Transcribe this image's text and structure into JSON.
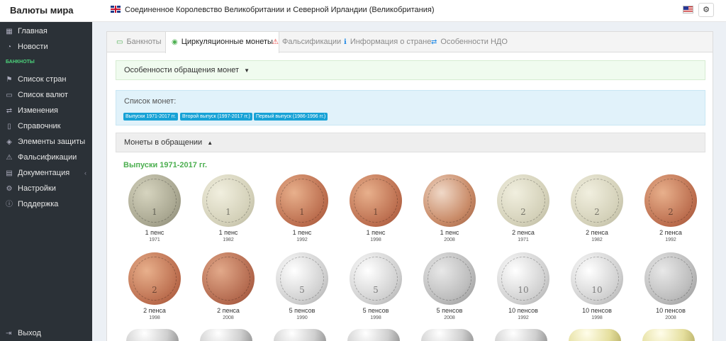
{
  "header": {
    "brand": "Валюты мира",
    "country": "Соединенное Королевство Великобритании и Северной Ирландии (Великобритания)",
    "settings_icon": "gear-icon"
  },
  "sidebar": {
    "section_label": "БАНКНОТЫ",
    "items": [
      {
        "label": "Главная",
        "icon": "dashboard-icon"
      },
      {
        "label": "Новости",
        "icon": "rss-icon"
      },
      {
        "label": "Список стран",
        "icon": "flag-icon"
      },
      {
        "label": "Список валют",
        "icon": "money-icon"
      },
      {
        "label": "Изменения",
        "icon": "exchange-icon"
      },
      {
        "label": "Справочник",
        "icon": "book-icon"
      },
      {
        "label": "Элементы защиты",
        "icon": "layers-icon"
      },
      {
        "label": "Фальсификации",
        "icon": "warning-icon"
      },
      {
        "label": "Документация",
        "icon": "folder-icon"
      },
      {
        "label": "Настройки",
        "icon": "gear-icon"
      },
      {
        "label": "Поддержка",
        "icon": "info-icon"
      }
    ],
    "logout": "Выход"
  },
  "tabs": [
    {
      "label": "Банкноты",
      "icon": "banknote-icon"
    },
    {
      "label": "Циркуляционные монеты",
      "icon": "coin-icon"
    },
    {
      "label": "Фальсификации",
      "icon": "warning-icon"
    },
    {
      "label": "Информация о стране",
      "icon": "info-icon"
    },
    {
      "label": "Особенности НДО",
      "icon": "exchange-icon"
    }
  ],
  "features_box": "Особенности обращения монет",
  "coin_list": {
    "label": "Список монет:",
    "badges": [
      "Выпуски 1971-2017 гг.",
      "Второй выпуск (1997-2017 гг.)",
      "Первый выпуск (1986-1996 гг.)"
    ]
  },
  "in_circulation": "Монеты в обращении",
  "issue_title": "Выпуски 1971-2017 гг.",
  "coins_row1": [
    {
      "name": "1 пенс",
      "year": "1971",
      "face": "1"
    },
    {
      "name": "1 пенс",
      "year": "1982",
      "face": "1"
    },
    {
      "name": "1 пенс",
      "year": "1992",
      "face": "1"
    },
    {
      "name": "1 пенс",
      "year": "1998",
      "face": "1"
    },
    {
      "name": "1 пенс",
      "year": "2008",
      "face": ""
    },
    {
      "name": "2 пенса",
      "year": "1971",
      "face": "2"
    },
    {
      "name": "2 пенса",
      "year": "1982",
      "face": "2"
    },
    {
      "name": "2 пенса",
      "year": "1992",
      "face": "2"
    }
  ],
  "coins_row2": [
    {
      "name": "2 пенса",
      "year": "1998",
      "face": "2"
    },
    {
      "name": "2 пенса",
      "year": "2008",
      "face": ""
    },
    {
      "name": "5 пенсов",
      "year": "1990",
      "face": "5"
    },
    {
      "name": "5 пенсов",
      "year": "1998",
      "face": "5"
    },
    {
      "name": "5 пенсов",
      "year": "2008",
      "face": ""
    },
    {
      "name": "10 пенсов",
      "year": "1992",
      "face": "10"
    },
    {
      "name": "10 пенсов",
      "year": "1998",
      "face": "10"
    },
    {
      "name": "10 пенсов",
      "year": "2008",
      "face": ""
    }
  ]
}
